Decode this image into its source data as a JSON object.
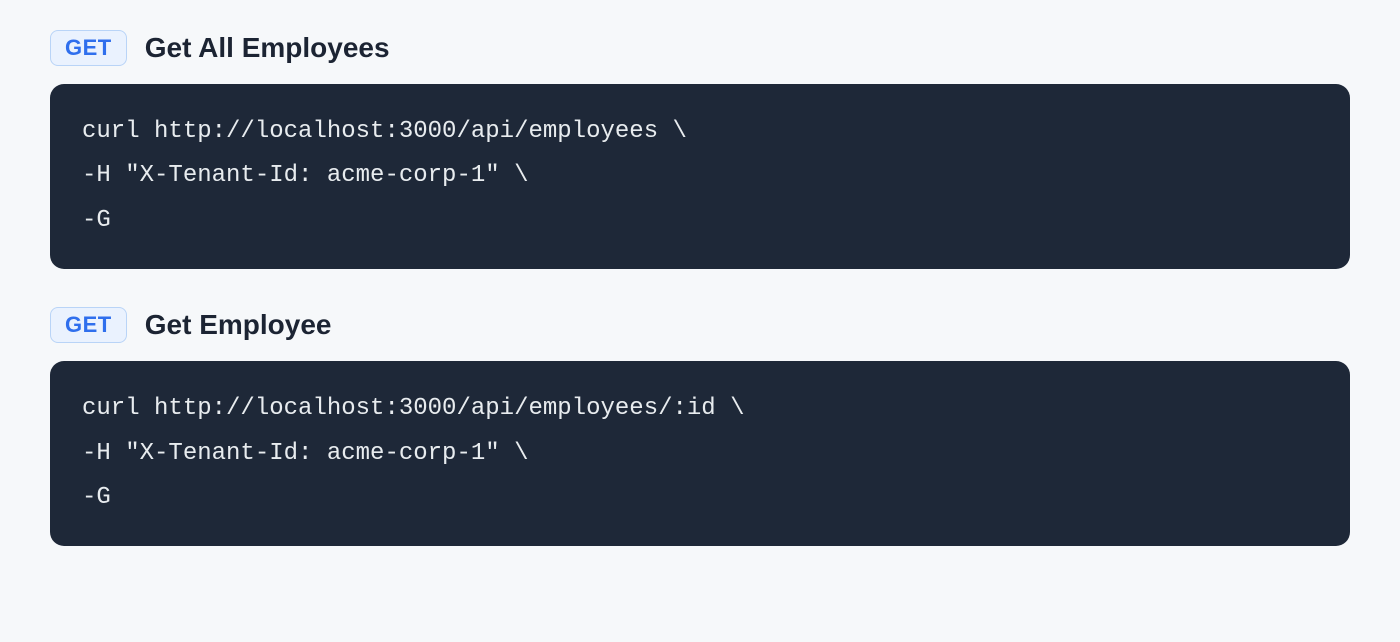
{
  "endpoints": [
    {
      "method": "GET",
      "title": "Get All Employees",
      "code": "curl http://localhost:3000/api/employees \\\n-H \"X-Tenant-Id: acme-corp-1\" \\\n-G"
    },
    {
      "method": "GET",
      "title": "Get Employee",
      "code": "curl http://localhost:3000/api/employees/:id \\\n-H \"X-Tenant-Id: acme-corp-1\" \\\n-G"
    }
  ]
}
